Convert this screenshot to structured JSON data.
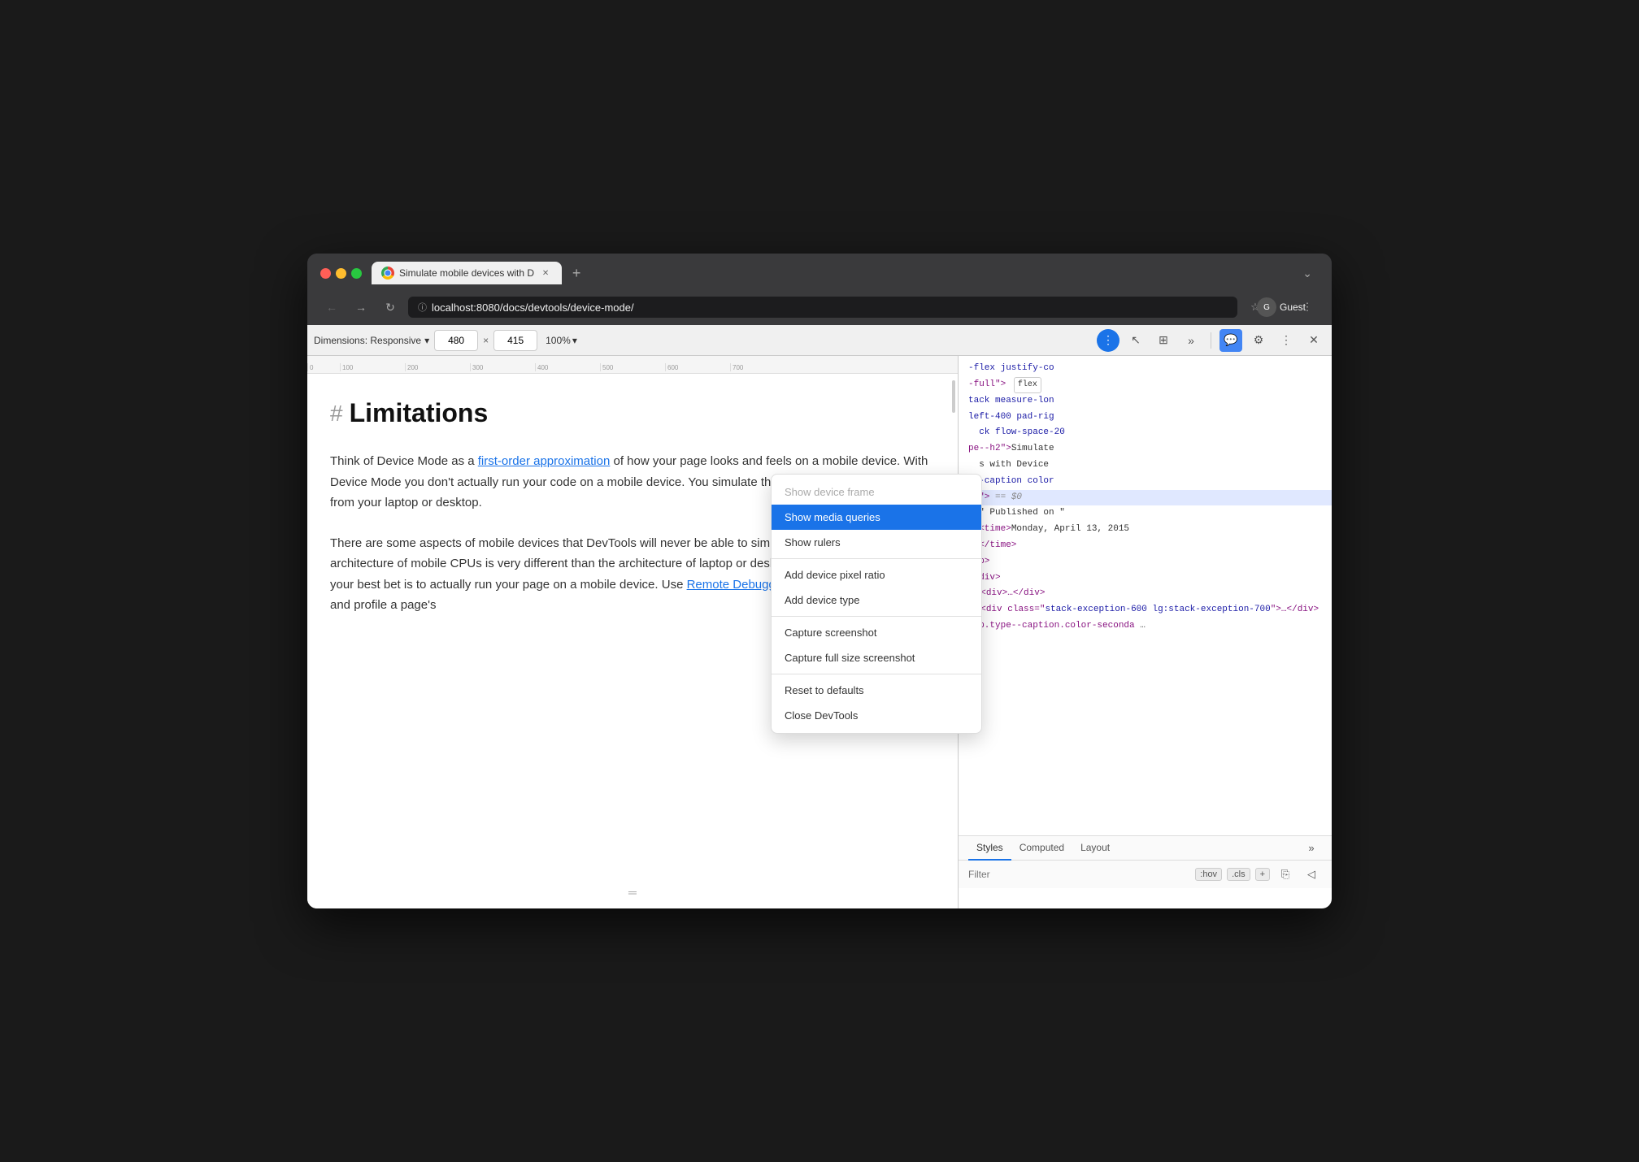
{
  "browser": {
    "tab": {
      "title": "Simulate mobile devices with D",
      "favicon": "chrome"
    },
    "url": "localhost:8080/docs/devtools/device-mode/",
    "guest_label": "Guest"
  },
  "devtools_toolbar": {
    "dimensions_label": "Dimensions: Responsive",
    "width_value": "480",
    "height_value": "415",
    "zoom_label": "100%",
    "x_label": "×"
  },
  "page": {
    "heading": "Limitations",
    "para1": "Think of Device Mode as a first-order approximation of how your page looks and feels on a mobile device. With Device Mode you don't actually run your code on a mobile device. You simulate the mobile user experience from your laptop or desktop.",
    "link1": "first-order approximation",
    "para2": "There are some aspects of mobile devices that DevTools will never be able to simulate. For example, the architecture of mobile CPUs is very different than the architecture of laptop or desktop CPUs. When in doubt, your best bet is to actually run your page on a mobile device. Use Remote Debugging to view, change, debug, and profile a page's",
    "link2": "Remote Debugging"
  },
  "dom_lines": [
    {
      "content": "-flex justify-co",
      "type": "code",
      "color": "#1a1aa6"
    },
    {
      "content": "-full\">",
      "type": "code",
      "badge": "flex"
    },
    {
      "content": "tack measure-lon",
      "type": "code",
      "color": "#1a1aa6"
    },
    {
      "content": "left-400 pad-rig",
      "type": "code",
      "color": "#1a1aa6"
    },
    {
      "content": "ck flow-space-20",
      "type": "code",
      "color": "#1a1aa6"
    },
    {
      "content": "pe--h2\">Simulate",
      "type": "code"
    },
    {
      "content": "s with Device",
      "type": "code"
    },
    {
      "content": "e--caption color",
      "type": "code"
    },
    {
      "content": "xt\"> == $0",
      "type": "code",
      "pseudo": true
    },
    {
      "content": "\" Published on \"",
      "type": "text"
    },
    {
      "content": "<time>Monday, April 13, 2015",
      "type": "tag"
    },
    {
      "content": "</time>",
      "type": "tag"
    },
    {
      "content": "</p>",
      "type": "tag"
    },
    {
      "content": "</div>",
      "type": "tag"
    },
    {
      "content": "<div>…</div>",
      "type": "tag",
      "collapsible": true
    },
    {
      "content": "<div class=\"stack-exception-600 lg:stack-exception-700\">…</div>",
      "type": "tag",
      "collapsible": true
    },
    {
      "content": "… p.type--caption.color-seconda …",
      "type": "selector"
    }
  ],
  "styles_tabs": [
    {
      "label": "Styles",
      "active": true
    },
    {
      "label": "Computed",
      "active": false
    },
    {
      "label": "Layout",
      "active": false
    }
  ],
  "styles_filter": {
    "placeholder": "Filter",
    "hov_label": ":hov",
    "cls_label": ".cls"
  },
  "context_menu": {
    "items": [
      {
        "label": "Show device frame",
        "disabled": true,
        "highlighted": false
      },
      {
        "label": "Show media queries",
        "disabled": false,
        "highlighted": true
      },
      {
        "label": "Show rulers",
        "disabled": false,
        "highlighted": false
      },
      {
        "label": "Add device pixel ratio",
        "disabled": false,
        "highlighted": false
      },
      {
        "label": "Add device type",
        "disabled": false,
        "highlighted": false
      },
      {
        "label": "Capture screenshot",
        "disabled": false,
        "highlighted": false
      },
      {
        "label": "Capture full size screenshot",
        "disabled": false,
        "highlighted": false
      },
      {
        "label": "Reset to defaults",
        "disabled": false,
        "highlighted": false
      },
      {
        "label": "Close DevTools",
        "disabled": false,
        "highlighted": false
      }
    ],
    "dividers_after": [
      2,
      4,
      6
    ]
  }
}
